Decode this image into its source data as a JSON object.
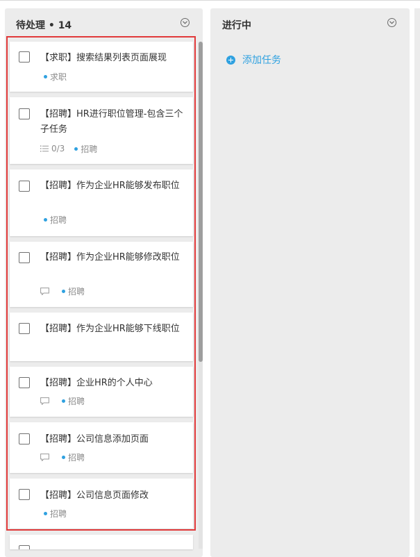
{
  "columns": [
    {
      "title": "待处理 • 14",
      "toggle_icon": "chevron-down-circle-icon"
    },
    {
      "title": "进行中",
      "toggle_icon": "chevron-down-circle-icon",
      "add_task_label": "添加任务",
      "add_icon": "plus-circle-icon"
    }
  ],
  "tasks": [
    {
      "title": "【求职】搜索结果列表页面展现",
      "tag": "求职"
    },
    {
      "title": "【招聘】HR进行职位管理-包含三个子任务",
      "subtasks": "0/3",
      "tag": "招聘"
    },
    {
      "title": "【招聘】作为企业HR能够发布职位",
      "tag": "招聘"
    },
    {
      "title": "【招聘】作为企业HR能够修改职位",
      "has_comment": true,
      "tag": "招聘"
    },
    {
      "title": "【招聘】作为企业HR能够下线职位"
    },
    {
      "title": "【招聘】企业HR的个人中心",
      "has_comment": true,
      "tag": "招聘"
    },
    {
      "title": "【招聘】公司信息添加页面",
      "has_comment": true,
      "tag": "招聘"
    },
    {
      "title": "【招聘】公司信息页面修改",
      "tag": "招聘"
    }
  ],
  "colors": {
    "accent": "#2fa1e0",
    "highlight": "#e1393a",
    "column_bg": "#ececec"
  }
}
